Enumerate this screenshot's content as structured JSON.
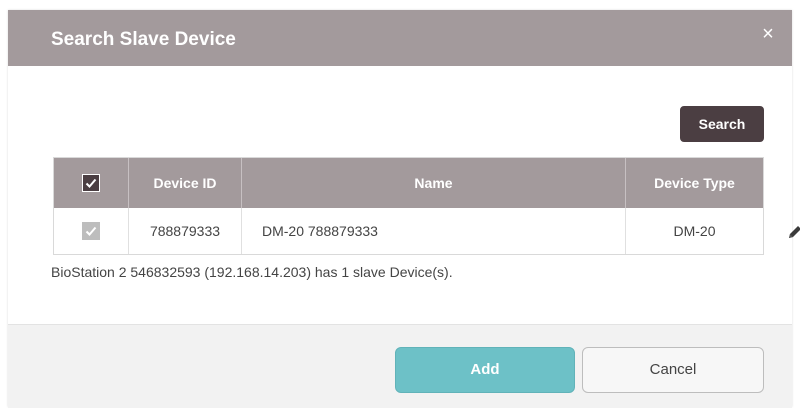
{
  "dialog": {
    "title": "Search Slave Device",
    "close_label": "×"
  },
  "toolbar": {
    "search_label": "Search"
  },
  "table": {
    "headers": {
      "device_id": "Device ID",
      "name": "Name",
      "device_type": "Device Type"
    },
    "select_all_checked": true,
    "rows": [
      {
        "checked": true,
        "device_id": "788879333",
        "name": "DM-20 788879333",
        "device_type": "DM-20"
      }
    ]
  },
  "status": "BioStation 2 546832593 (192.168.14.203) has 1 slave Device(s).",
  "footer": {
    "add_label": "Add",
    "cancel_label": "Cancel"
  },
  "colors": {
    "title_bar": "#a39a9c",
    "dark_button": "#4b3e42",
    "primary_button": "#6dc1c7"
  }
}
